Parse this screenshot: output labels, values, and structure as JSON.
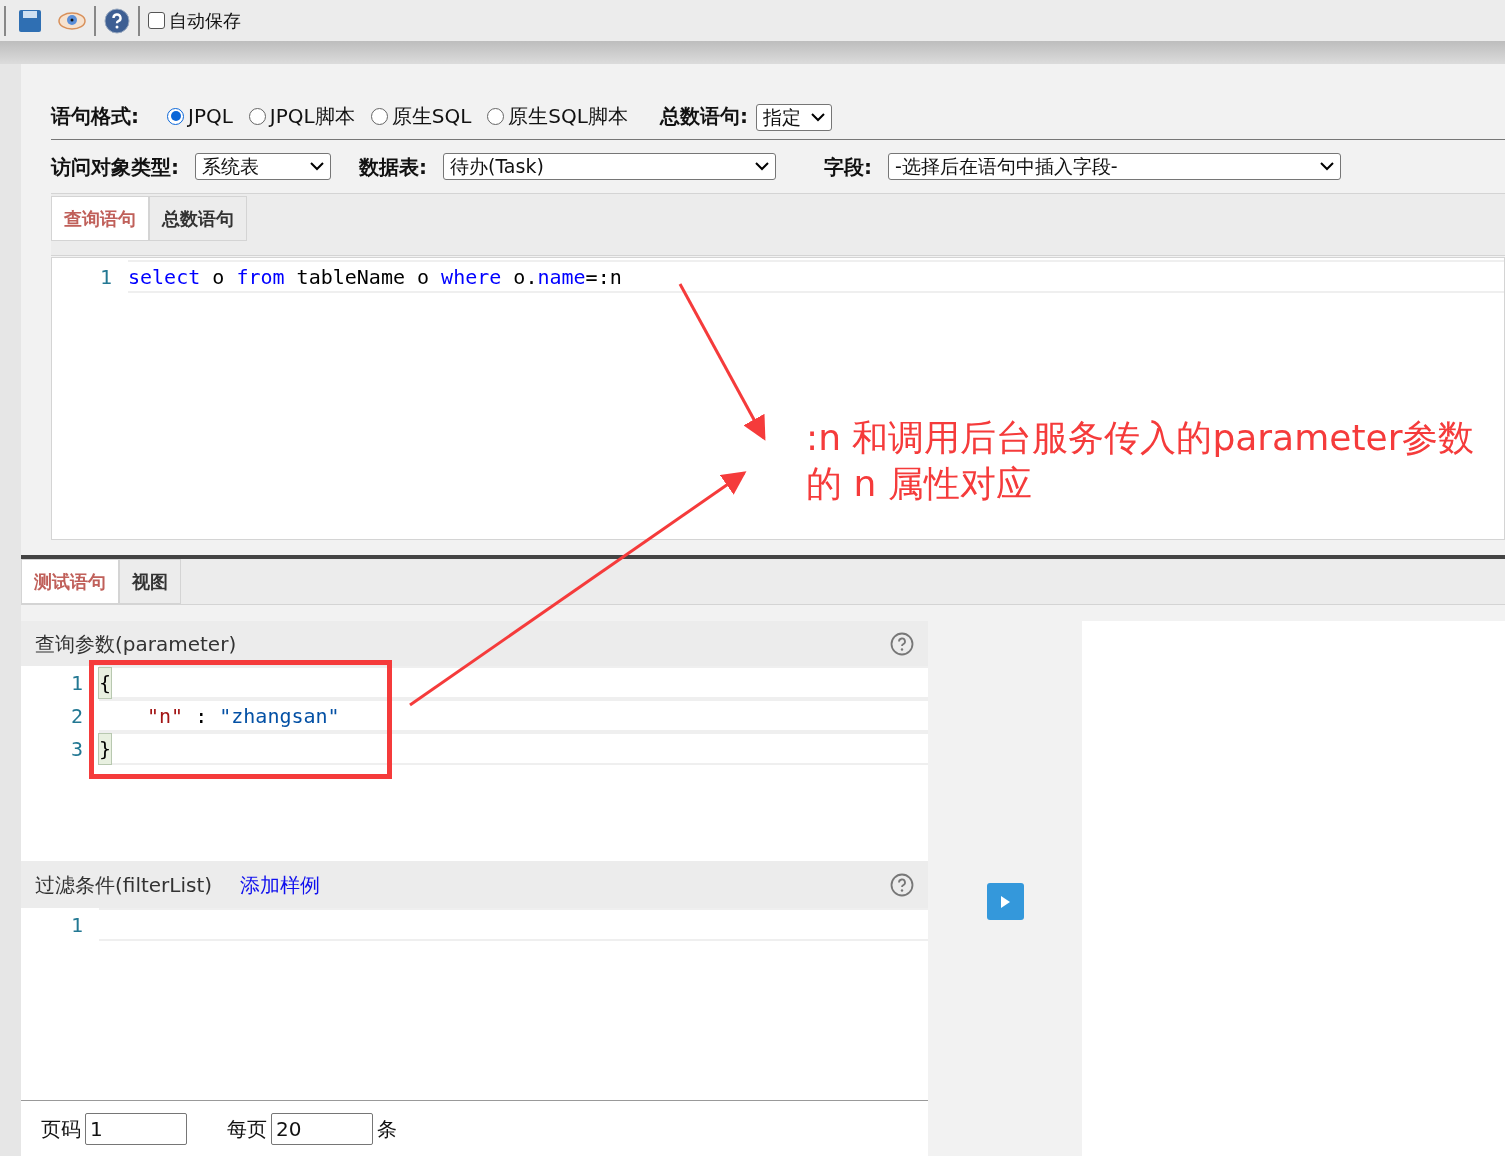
{
  "toolbar": {
    "autosave": {
      "label": "自动保存",
      "checked": false
    }
  },
  "format": {
    "label": "语句格式:",
    "options": [
      {
        "label": "JPQL",
        "selected": true
      },
      {
        "label": "JPQL脚本",
        "selected": false
      },
      {
        "label": "原生SQL",
        "selected": false
      },
      {
        "label": "原生SQL脚本",
        "selected": false
      }
    ],
    "count_label": "总数语句:",
    "count_value": "指定"
  },
  "target": {
    "type_label": "访问对象类型:",
    "type_value": "系统表",
    "table_label": "数据表:",
    "table_value": "待办(Task)",
    "field_label": "字段:",
    "field_value": "-选择后在语句中插入字段-"
  },
  "query_tabs": [
    {
      "label": "查询语句",
      "selected": true
    },
    {
      "label": "总数语句",
      "selected": false
    }
  ],
  "query_editor": {
    "lines": [
      {
        "number": "1",
        "tokens": [
          {
            "text": "select",
            "kind": "keyword"
          },
          {
            "text": " o ",
            "kind": "plain"
          },
          {
            "text": "from",
            "kind": "keyword"
          },
          {
            "text": " tableName o ",
            "kind": "plain"
          },
          {
            "text": "where",
            "kind": "keyword"
          },
          {
            "text": " o.",
            "kind": "plain"
          },
          {
            "text": "name",
            "kind": "keyword"
          },
          {
            "text": "=:n",
            "kind": "plain"
          }
        ]
      }
    ]
  },
  "test_tabs": [
    {
      "label": "测试语句",
      "selected": true
    },
    {
      "label": "视图",
      "selected": false
    }
  ],
  "parameter_panel": {
    "title": "查询参数(parameter)",
    "lines": [
      {
        "number": "1",
        "tokens": [
          {
            "text": "{",
            "kind": "bracket"
          }
        ]
      },
      {
        "number": "2",
        "indented": true,
        "tokens": [
          {
            "text": "\"n\"",
            "kind": "key"
          },
          {
            "text": " : ",
            "kind": "plain"
          },
          {
            "text": "\"zhangsan\"",
            "kind": "string"
          }
        ]
      },
      {
        "number": "3",
        "tokens": [
          {
            "text": "}",
            "kind": "bracket"
          }
        ]
      }
    ]
  },
  "filter_panel": {
    "title": "过滤条件(filterList)",
    "link": "添加样例",
    "lines": [
      {
        "number": "1"
      }
    ]
  },
  "pager": {
    "page_label": "页码",
    "page_value": "1",
    "size_label": "每页",
    "size_value": "20",
    "unit": "条"
  },
  "annotation": {
    "lines": [
      ":n 和调用后台服务传入的parameter参数",
      "的 n 属性对应"
    ]
  }
}
